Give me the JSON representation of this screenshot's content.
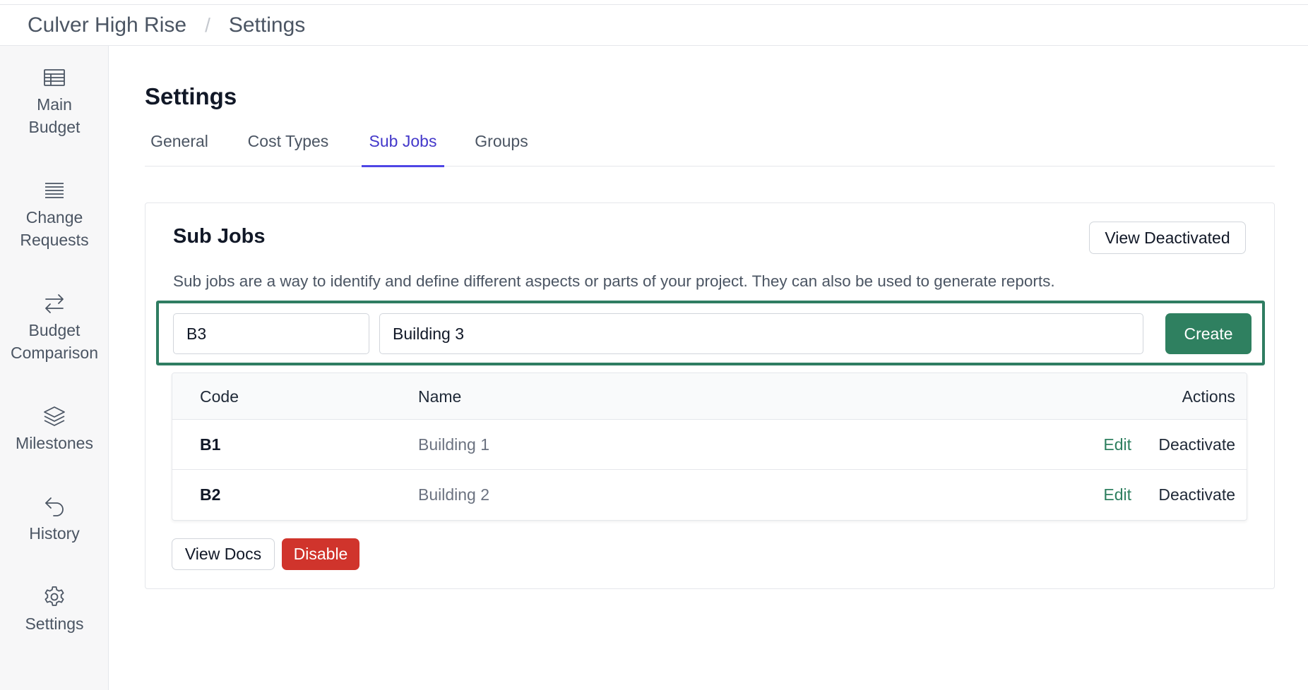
{
  "breadcrumb": {
    "project": "Culver High Rise",
    "separator": "/",
    "page": "Settings"
  },
  "sidebar": {
    "items": [
      {
        "label": "Main\nBudget",
        "icon": "table-icon"
      },
      {
        "label": "Change\nRequests",
        "icon": "list-icon"
      },
      {
        "label": "Budget\nComparison",
        "icon": "arrows-swap-icon"
      },
      {
        "label": "Milestones",
        "icon": "layers-icon"
      },
      {
        "label": "History",
        "icon": "undo-arrow-icon"
      },
      {
        "label": "Settings",
        "icon": "gear-icon"
      }
    ]
  },
  "page": {
    "title": "Settings"
  },
  "tabs": [
    {
      "label": "General",
      "active": false
    },
    {
      "label": "Cost Types",
      "active": false
    },
    {
      "label": "Sub Jobs",
      "active": true
    },
    {
      "label": "Groups",
      "active": false
    }
  ],
  "subjobs": {
    "title": "Sub Jobs",
    "view_deactivated_label": "View Deactivated",
    "description": "Sub jobs are a way to identify and define different aspects or parts of your project. They can also be used to generate reports.",
    "form": {
      "code_value": "B3",
      "name_value": "Building 3",
      "create_label": "Create"
    },
    "table": {
      "headers": {
        "code": "Code",
        "name": "Name",
        "actions": "Actions"
      },
      "rows": [
        {
          "code": "B1",
          "name": "Building 1",
          "edit": "Edit",
          "deactivate": "Deactivate"
        },
        {
          "code": "B2",
          "name": "Building 2",
          "edit": "Edit",
          "deactivate": "Deactivate"
        }
      ]
    },
    "view_docs_label": "View Docs",
    "disable_label": "Disable"
  },
  "colors": {
    "accent_tab": "#4f46e5",
    "primary_green": "#2f8060",
    "danger_red": "#d0342c"
  }
}
